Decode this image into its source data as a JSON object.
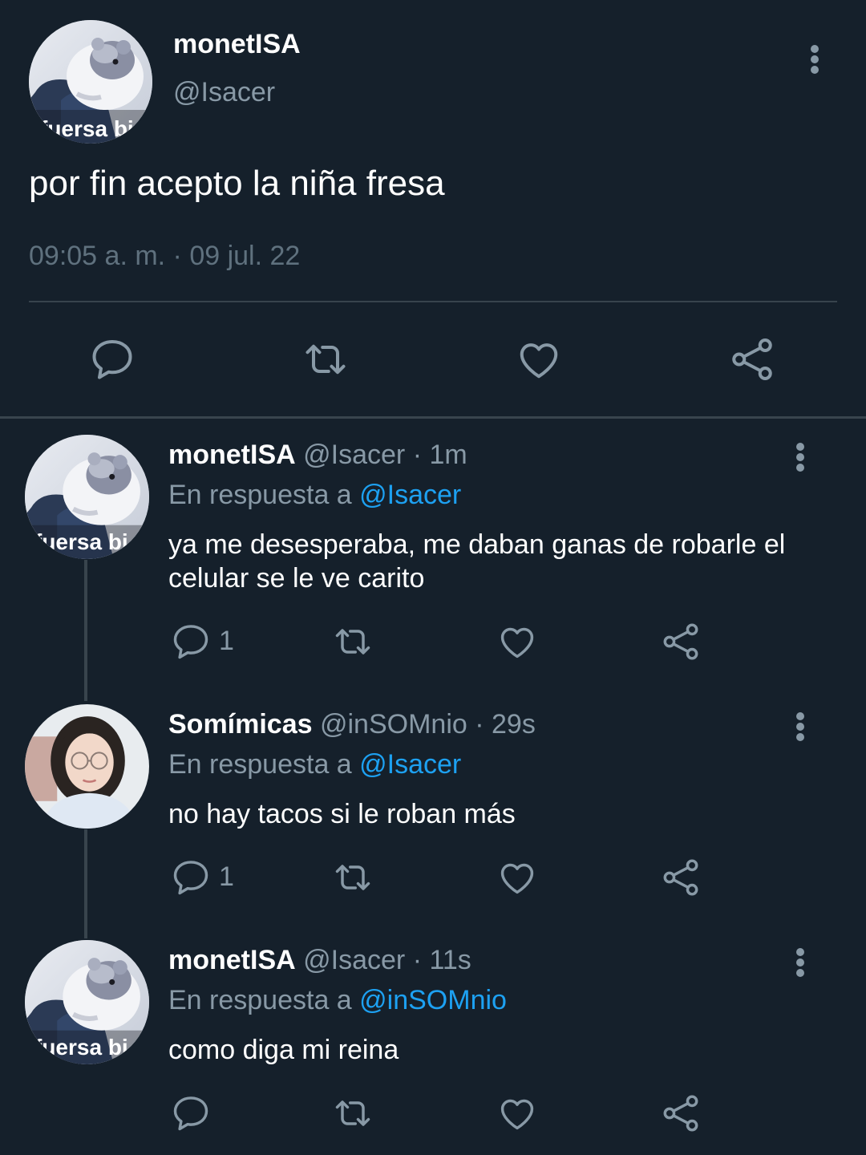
{
  "main_tweet": {
    "display_name": "monetISA",
    "handle": "@Isacer",
    "avatar_caption": "fuersa bi",
    "text": "por fin acepto la niña fresa",
    "timestamp": "09:05 a. m. · 09 jul. 22",
    "actions": [
      "reply-icon",
      "retweet-icon",
      "like-icon",
      "share-icon"
    ]
  },
  "replies": [
    {
      "display_name": "monetISA",
      "meta": "@Isacer · 1m",
      "in_reply_prefix": "En respuesta a ",
      "in_reply_to": "@Isacer",
      "text": "ya me desesperaba, me daban ganas de robarle el celular se le ve carito",
      "reply_count": "1",
      "avatar_caption": "fuersa bi"
    },
    {
      "display_name": "Somímicas",
      "meta": "@inSOMnio · 29s",
      "in_reply_prefix": "En respuesta a ",
      "in_reply_to": "@Isacer",
      "text": "no hay tacos si le roban más",
      "reply_count": "1"
    },
    {
      "display_name": "monetISA",
      "meta": "@Isacer · 11s",
      "in_reply_prefix": "En respuesta a ",
      "in_reply_to": "@inSOMnio",
      "text": "como diga mi reina",
      "reply_count": "",
      "avatar_caption": "fuersa bi"
    }
  ],
  "colors": {
    "background": "#15202b",
    "secondary_text": "#8899a6",
    "link": "#1da1f2",
    "divider": "#38444d"
  }
}
